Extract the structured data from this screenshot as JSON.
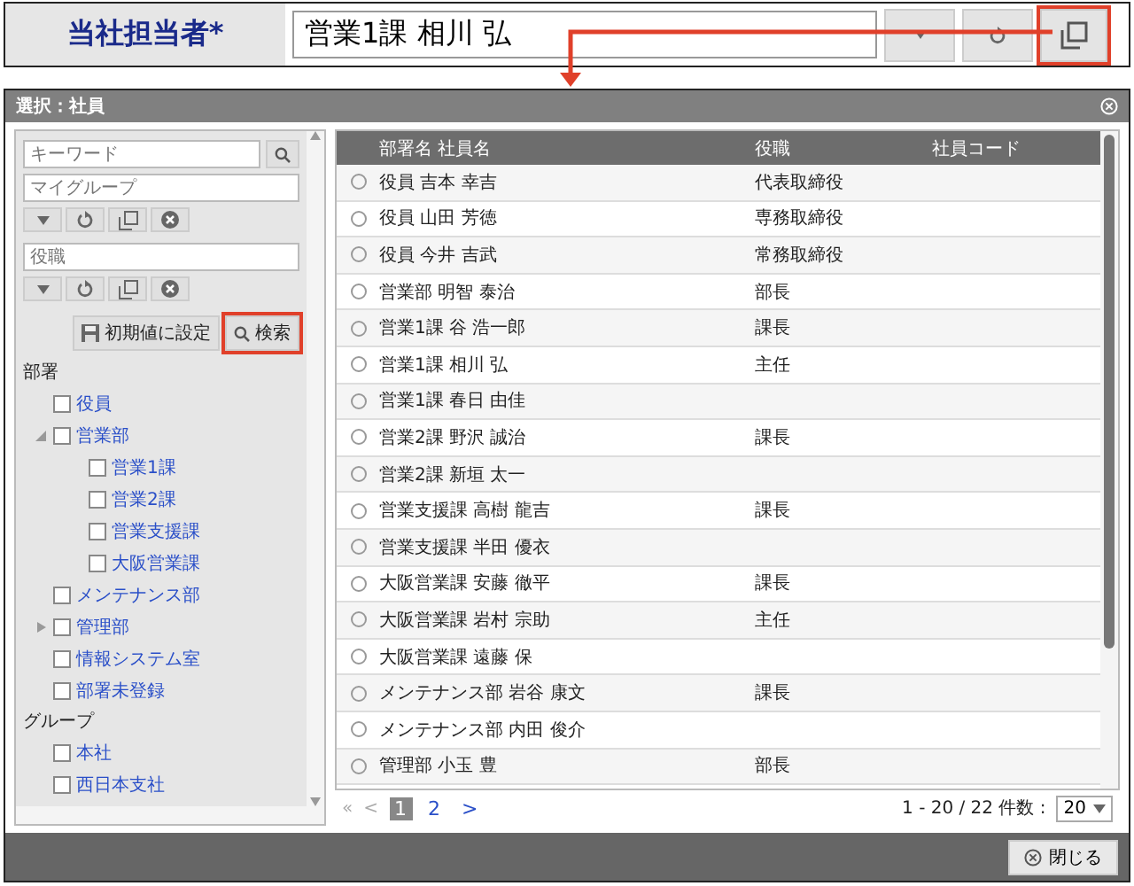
{
  "field": {
    "label": "当社担当者*",
    "value": "営業1課 相川 弘"
  },
  "dialog": {
    "title": "選択：社員",
    "filters": [
      {
        "placeholder": "キーワード",
        "kind": "search"
      },
      {
        "placeholder": "マイグループ",
        "kind": "tools"
      },
      {
        "placeholder": "役職",
        "kind": "tools"
      }
    ],
    "reset_button": "初期値に設定",
    "search_button": "検索",
    "tree_sections": [
      {
        "heading": "部署",
        "items": [
          {
            "label": "役員",
            "kind": "leaf",
            "checked": false
          },
          {
            "label": "営業部",
            "kind": "branch",
            "expanded": true,
            "checked": false,
            "children": [
              {
                "label": "営業1課",
                "kind": "leaf",
                "checked": false
              },
              {
                "label": "営業2課",
                "kind": "leaf",
                "checked": false
              },
              {
                "label": "営業支援課",
                "kind": "leaf",
                "checked": false
              },
              {
                "label": "大阪営業課",
                "kind": "leaf",
                "checked": false
              }
            ]
          },
          {
            "label": "メンテナンス部",
            "kind": "leaf",
            "checked": false
          },
          {
            "label": "管理部",
            "kind": "branch",
            "expanded": false,
            "checked": false
          },
          {
            "label": "情報システム室",
            "kind": "leaf",
            "checked": false
          },
          {
            "label": "部署未登録",
            "kind": "leaf",
            "checked": false
          }
        ]
      },
      {
        "heading": "グループ",
        "items": [
          {
            "label": "本社",
            "kind": "leaf",
            "checked": false
          },
          {
            "label": "西日本支社",
            "kind": "leaf",
            "checked": false
          }
        ]
      }
    ],
    "table": {
      "columns": [
        "部署名 社員名",
        "役職",
        "社員コード"
      ],
      "rows": [
        {
          "name": "役員 吉本 幸吉",
          "role": "代表取締役",
          "selected": false
        },
        {
          "name": "役員 山田 芳徳",
          "role": "専務取締役",
          "selected": false
        },
        {
          "name": "役員 今井 吉武",
          "role": "常務取締役",
          "selected": false
        },
        {
          "name": "営業部 明智 泰治",
          "role": "部長",
          "selected": false
        },
        {
          "name": "営業1課 谷 浩一郎",
          "role": "課長",
          "selected": false
        },
        {
          "name": "営業1課 相川 弘",
          "role": "主任",
          "selected": false
        },
        {
          "name": "営業1課 春日 由佳",
          "selected": false
        },
        {
          "name": "営業2課 野沢 誠治",
          "role": "課長",
          "selected": false
        },
        {
          "name": "営業2課 新垣 太一",
          "selected": false
        },
        {
          "name": "営業支援課 高樹 龍吉",
          "role": "課長",
          "selected": false
        },
        {
          "name": "営業支援課 半田 優衣",
          "selected": false
        },
        {
          "name": "大阪営業課 安藤 徹平",
          "role": "課長",
          "selected": false
        },
        {
          "name": "大阪営業課 岩村 宗助",
          "role": "主任",
          "selected": false
        },
        {
          "name": "大阪営業課 遠藤 保",
          "selected": false
        },
        {
          "name": "メンテナンス部 岩谷 康文",
          "role": "課長",
          "selected": false
        },
        {
          "name": "メンテナンス部 内田 俊介",
          "selected": false
        },
        {
          "name": "管理部 小玉 豊",
          "role": "部長",
          "selected": false
        }
      ]
    },
    "pager": {
      "first": "«",
      "prev": "<",
      "pages": [
        {
          "label": "1",
          "selected": true
        },
        {
          "label": "2",
          "selected": false
        }
      ],
      "next": ">",
      "info": "1 - 20 / 22 件数 :",
      "page_size": "20"
    },
    "close_button": "閉じる"
  }
}
